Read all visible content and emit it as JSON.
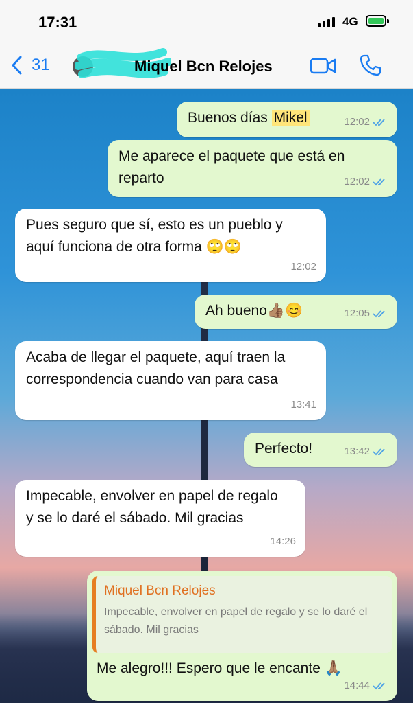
{
  "status": {
    "time": "17:31",
    "network": "4G"
  },
  "header": {
    "back_count": "31",
    "contact_name": "Miquel Bcn Relojes"
  },
  "messages": [
    {
      "dir": "out",
      "text": "Buenos días ",
      "highlight": "Mikel",
      "time": "12:02"
    },
    {
      "dir": "out",
      "text": "Me aparece el paquete que está en reparto",
      "time": "12:02"
    },
    {
      "dir": "in",
      "text": "Pues seguro que sí, esto es un pueblo y aquí funciona de otra forma 🙄🙄",
      "time": "12:02"
    },
    {
      "dir": "out",
      "text": "Ah bueno👍🏽😊",
      "time": "12:05"
    },
    {
      "dir": "in",
      "text": "Acaba de llegar el paquete, aquí traen la correspondencia cuando van para casa",
      "time": "13:41"
    },
    {
      "dir": "out",
      "text": "Perfecto!",
      "time": "13:42"
    },
    {
      "dir": "in",
      "text": "Impecable, envolver en papel de regalo y se lo daré el sábado. Mil gracias",
      "time": "14:26"
    },
    {
      "dir": "out",
      "text": "Me alegro!!! Espero que le encante 🙏🏽",
      "time": "14:44",
      "quote": {
        "author": "Miquel Bcn Relojes",
        "text": "Impecable, envolver en papel de regalo y se lo daré el sábado. Mil gracias"
      }
    }
  ],
  "colors": {
    "accent": "#1a7cf2",
    "outgoing": "#e3f8cf",
    "incoming": "#ffffff",
    "read_ticks": "#4fa3e6",
    "quote_author": "#e07020"
  }
}
